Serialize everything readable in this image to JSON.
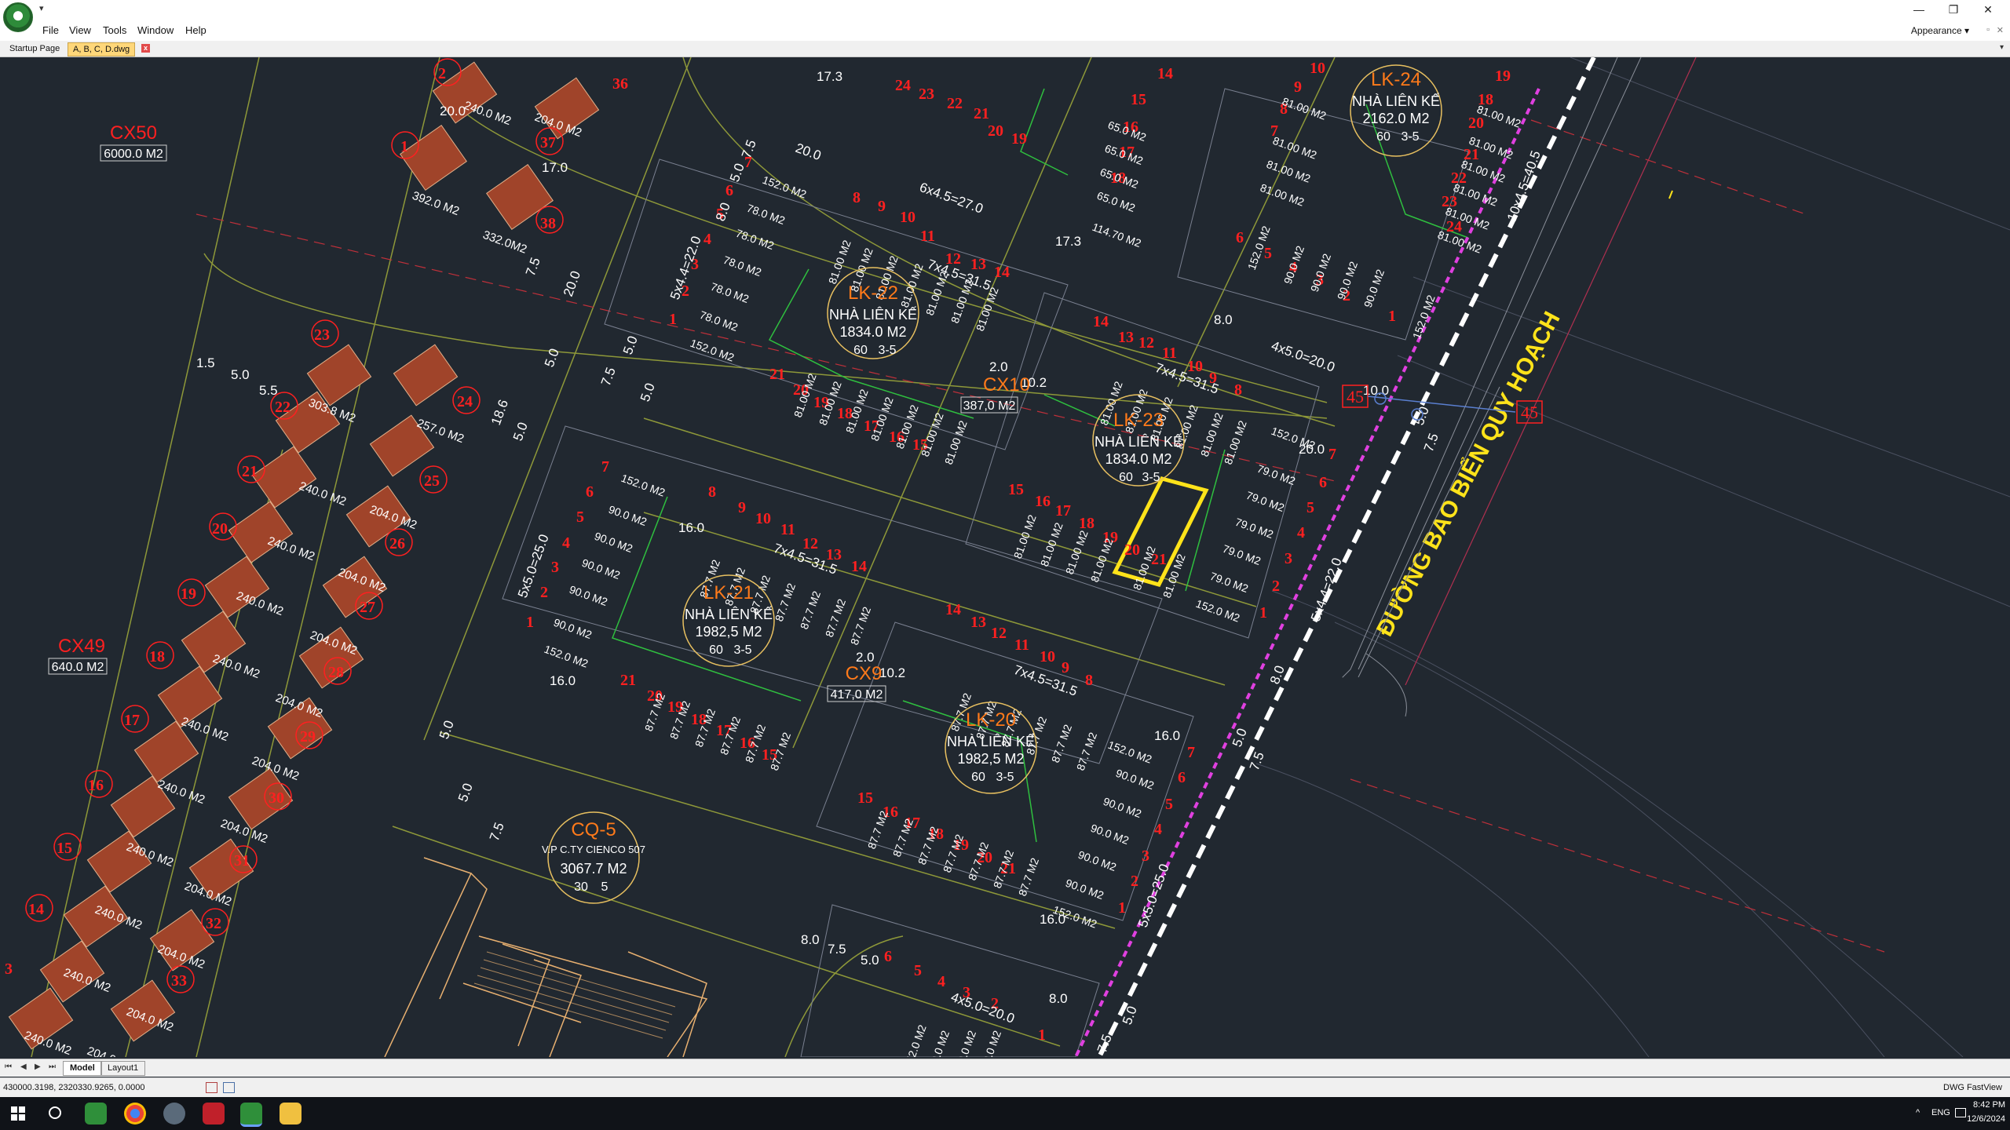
{
  "window": {
    "qat_arrow": "▾",
    "minimize": "—",
    "restore": "❐",
    "close": "✕"
  },
  "menu": {
    "items": [
      "File",
      "View",
      "Tools",
      "Window",
      "Help"
    ],
    "appearance": "Appearance ▾",
    "mini_restore": "▫",
    "mini_close": "✕"
  },
  "tabs": {
    "startup": "Startup Page",
    "document": "A, B, C, D.dwg",
    "close": "x",
    "menu": "▾"
  },
  "drawing": {
    "lots": [
      {
        "code": "LK-24",
        "type": "NHÀ LIÊN KẾ",
        "area": "2162.0 M2",
        "density": "60",
        "floors": "3-5"
      },
      {
        "code": "LK-22",
        "type": "NHÀ LIÊN KẾ",
        "area": "1834.0 M2",
        "density": "60",
        "floors": "3-5"
      },
      {
        "code": "LK-23",
        "type": "NHÀ LIÊN KẾ",
        "area": "1834.0 M2",
        "density": "60",
        "floors": "3-5"
      },
      {
        "code": "LK-21",
        "type": "NHÀ LIÊN KẾ",
        "area": "1982,5 M2",
        "density": "60",
        "floors": "3-5"
      },
      {
        "code": "LK-20",
        "type": "NHÀ LIÊN KẾ",
        "area": "1982,5 M2",
        "density": "60",
        "floors": "3-5"
      },
      {
        "code": "CQ-5",
        "type": "V.P C.TY CIENCO 507",
        "area": "3067.7 M2",
        "density": "30",
        "floors": "5"
      }
    ],
    "green_areas": [
      {
        "code": "CX50",
        "area": "6000.0 M2"
      },
      {
        "code": "CX49",
        "area": "640.0 M2"
      },
      {
        "code": "CX10",
        "area": "387,0 M2"
      },
      {
        "code": "CX9",
        "area": "417,0 M2"
      }
    ],
    "road_name": "ĐƯỜNG BAO BIỂN QUY HOẠCH",
    "road_marker": "45",
    "dimensions": [
      "7x4.5=31.5",
      "7x4.5=31.5",
      "7x4.5=31.5",
      "7x4.5=31.5",
      "5x4.4=22.0",
      "5x4.4=22.0",
      "10x4.5=40.5",
      "4x5.0=20.0",
      "4x5.0=20.0",
      "5x5.0=25.0",
      "5x5.0=25.0",
      "6x4.5=27.0"
    ],
    "plot_areas": [
      "81.00 M2",
      "87.7 M2",
      "240.0 M2",
      "204.0 M2",
      "79.0 M2",
      "90.0 M2",
      "152.0 M2",
      "392.0 M2",
      "332.0M2",
      "303.8 M2",
      "257.0 M2"
    ],
    "widths": [
      "20.0",
      "17.3",
      "10.0",
      "8.0",
      "5.0",
      "7.5",
      "16.0",
      "10.2",
      "2.0",
      "17.0",
      "1.5",
      "5.5",
      "18.6"
    ]
  },
  "layout_tabs": {
    "nav": [
      "⏮",
      "◀",
      "▶",
      "⏭"
    ],
    "model": "Model",
    "layout1": "Layout1"
  },
  "status": {
    "coordinates": "430000.3198, 2320330.9265, 0.0000",
    "product": "DWG FastView"
  },
  "taskbar": {
    "language": "ENG",
    "time": "8:42 PM",
    "date": "12/6/2024",
    "tray_arrow": "^"
  },
  "colors": {
    "canvas": "#212830",
    "block_number": "#ff2020",
    "lot_label": "#ff7a1a",
    "road_label": "#ffe31a",
    "selection": "#ffe31a",
    "dashed_line": "#e040e0",
    "building": "#a0442a"
  }
}
